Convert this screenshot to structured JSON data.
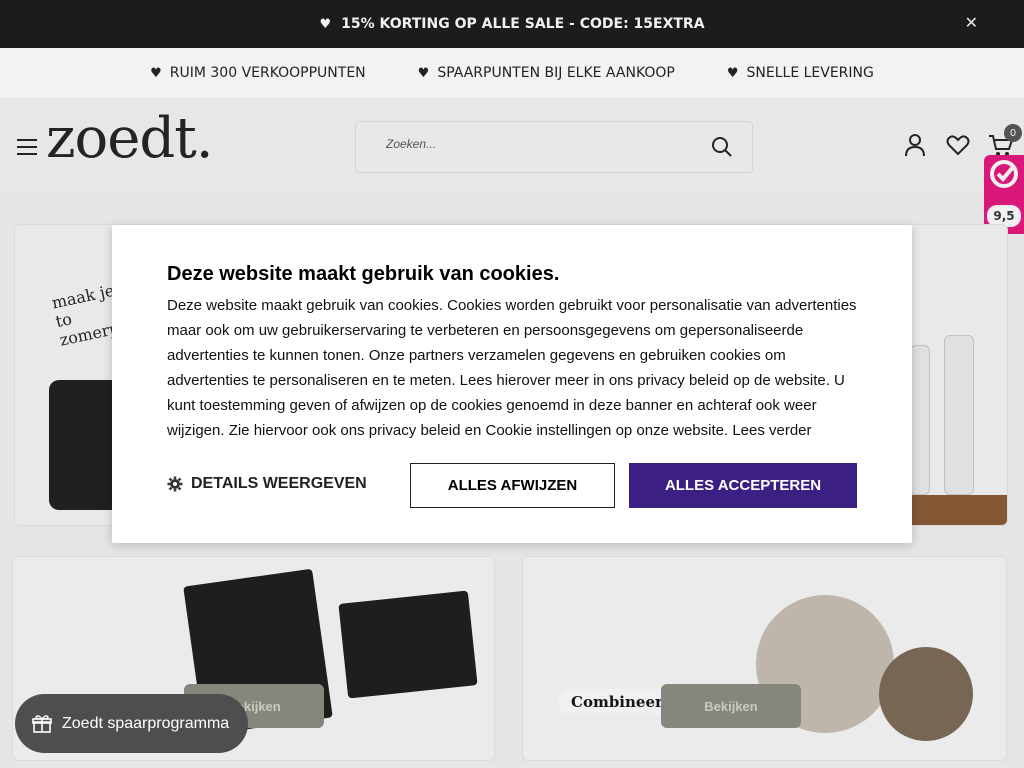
{
  "announcement": {
    "text": "15% KORTING OP ALLE SALE - CODE: 15EXTRA",
    "close_icon": "close-icon"
  },
  "usps": [
    {
      "label": "RUIM 300 VERKOOPPUNTEN"
    },
    {
      "label": "SPAARPUNTEN BIJ ELKE AANKOOP"
    },
    {
      "label": "SNELLE LEVERING"
    }
  ],
  "header": {
    "logo": "zoedt.",
    "search_placeholder": "Zoeken...",
    "cart_count": "0"
  },
  "rating": {
    "score": "9,5"
  },
  "banners": {
    "tile1_text": "maak je to zomerpro",
    "tile4_tag": "Combineer!",
    "button_label": "Bekijken"
  },
  "cookie": {
    "title": "Deze website maakt gebruik van cookies.",
    "body": "Deze website maakt gebruik van cookies. Cookies worden gebruikt voor personalisatie van advertenties maar ook om uw gebruikerservaring te verbeteren en persoonsgegevens om gepersonaliseerde advertenties te kunnen tonen. Onze partners verzamelen gegevens en gebruiken cookies om advertenties te personaliseren en te meten. Lees hierover meer in ons privacy beleid op de website. U kunt toestemming geven of afwijzen op de cookies genoemd in deze banner en achteraf ook weer wijzigen. Zie hiervoor ook ons privacy beleid en Cookie instellingen op onze website. Lees verder",
    "details_label": "DETAILS WEERGEVEN",
    "reject_label": "ALLES AFWIJZEN",
    "accept_label": "ALLES ACCEPTEREN",
    "accent_color": "#3b1f82"
  },
  "savings": {
    "label": "Zoedt spaarprogramma"
  }
}
